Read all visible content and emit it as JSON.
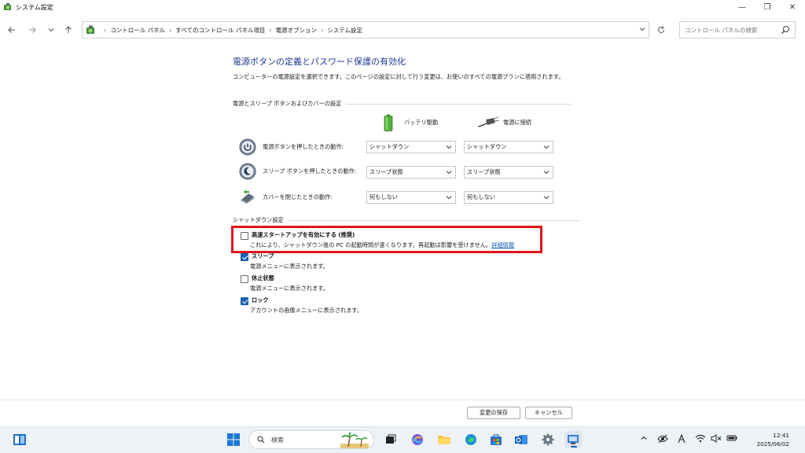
{
  "window": {
    "title": "システム設定",
    "minimize": "—",
    "restore": "❐",
    "close": "✕"
  },
  "address": {
    "crumbs": [
      "コントロール パネル",
      "すべてのコントロール パネル項目",
      "電源オプション",
      "システム設定"
    ],
    "search_placeholder": "コントロール パネルの検索"
  },
  "page": {
    "title": "電源ボタンの定義とパスワード保護の有効化",
    "description": "コンピューターの電源設定を選択できます。このページの設定に対して行う変更は、お使いのすべての電源プランに適用されます。",
    "section_buttons": "電源とスリープ ボタンおよびカバーの設定",
    "col_battery": "バッテリ駆動",
    "col_plugged": "電源に接続",
    "rows": [
      {
        "label": "電源ボタンを押したときの動作:",
        "battery": "シャットダウン",
        "plugged": "シャットダウン"
      },
      {
        "label": "スリープ ボタンを押したときの動作:",
        "battery": "スリープ状態",
        "plugged": "スリープ状態"
      },
      {
        "label": "カバーを閉じたときの動作:",
        "battery": "何もしない",
        "plugged": "何もしない"
      }
    ],
    "section_shutdown": "シャットダウン設定",
    "options": [
      {
        "title": "高速スタートアップを有効にする (推奨)",
        "desc": "これにより、シャットダウン後の PC の起動時間が速くなります。再起動は影響を受けません。",
        "link": "詳細情報",
        "checked": false
      },
      {
        "title": "スリープ",
        "desc": "電源メニューに表示されます。",
        "checked": true
      },
      {
        "title": "休止状態",
        "desc": "電源メニューに表示されます。",
        "checked": false
      },
      {
        "title": "ロック",
        "desc": "アカウントの画像メニューに表示されます。",
        "checked": true
      }
    ],
    "save_label": "変更の保存",
    "cancel_label": "キャンセル"
  },
  "taskbar": {
    "search_label": "検索",
    "time": "12:41",
    "date": "2025/06/02"
  },
  "colors": {
    "accent": "#1a5fb4",
    "title_blue": "#1e3a96",
    "highlight_red": "#e1141c"
  }
}
